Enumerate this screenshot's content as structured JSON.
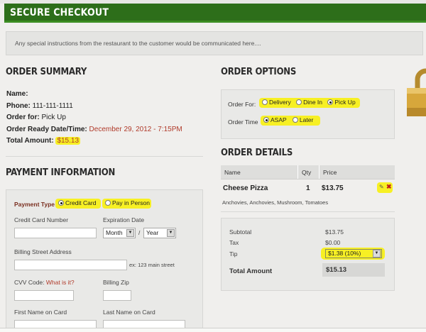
{
  "header": {
    "title": "SECURE CHECKOUT"
  },
  "notice": {
    "text": "Any special instructions from the restaurant to the customer would be communicated here...."
  },
  "order_summary": {
    "heading": "ORDER SUMMARY",
    "name_label": "Name:",
    "name_value": "",
    "phone_label": "Phone:",
    "phone_value": "111-111-1111",
    "order_for_label": "Order for:",
    "order_for_value": "Pick Up",
    "ready_label": "Order Ready Date/Time:",
    "ready_value": "December 29, 2012 - 7:15PM",
    "total_label": "Total Amount:",
    "total_value": "$15.13"
  },
  "payment": {
    "heading": "PAYMENT INFORMATION",
    "type_label": "Payment Type",
    "options": [
      "Credit Card",
      "Pay in Person"
    ],
    "selected": "Credit Card",
    "cc_number_label": "Credit Card Number",
    "cc_number_value": "",
    "expiration_label": "Expiration Date",
    "month_value": "Month",
    "year_value": "Year",
    "exp_separator": "/",
    "street_label": "Billing Street Address",
    "street_value": "",
    "street_hint": "ex: 123 main street",
    "cvv_label": "CVV Code:",
    "cvv_link": "What is it?",
    "zip_label": "Billing Zip",
    "first_name_label": "First Name on Card",
    "last_name_label": "Last Name on Card"
  },
  "order_options": {
    "heading": "ORDER OPTIONS",
    "order_for_label": "Order For:",
    "order_for_options": [
      "Delivery",
      "Dine In",
      "Pick Up"
    ],
    "order_for_selected": "Pick Up",
    "order_time_label": "Order Time",
    "order_time_options": [
      "ASAP",
      "Later"
    ],
    "order_time_selected": "ASAP"
  },
  "order_details": {
    "heading": "ORDER DETAILS",
    "columns": [
      "Name",
      "Qty",
      "Price"
    ],
    "items": [
      {
        "name": "Cheese Pizza",
        "qty": "1",
        "price": "$13.75",
        "toppings": "Anchovies, Anchovies, Mushroom, Tomatoes"
      }
    ]
  },
  "totals": {
    "subtotal_label": "Subtotal",
    "subtotal_value": "$13.75",
    "tax_label": "Tax",
    "tax_value": "$0.00",
    "tip_label": "Tip",
    "tip_value": "$1.38 (10%)",
    "total_label": "Total Amount",
    "total_value": "$15.13"
  },
  "colors": {
    "header_green": "#2d6e1a",
    "highlight_yellow": "#f7f024",
    "accent_red": "#b03a2a"
  },
  "icons": [
    "edit-icon",
    "delete-icon",
    "padlock-icon",
    "chevron-down-icon"
  ]
}
